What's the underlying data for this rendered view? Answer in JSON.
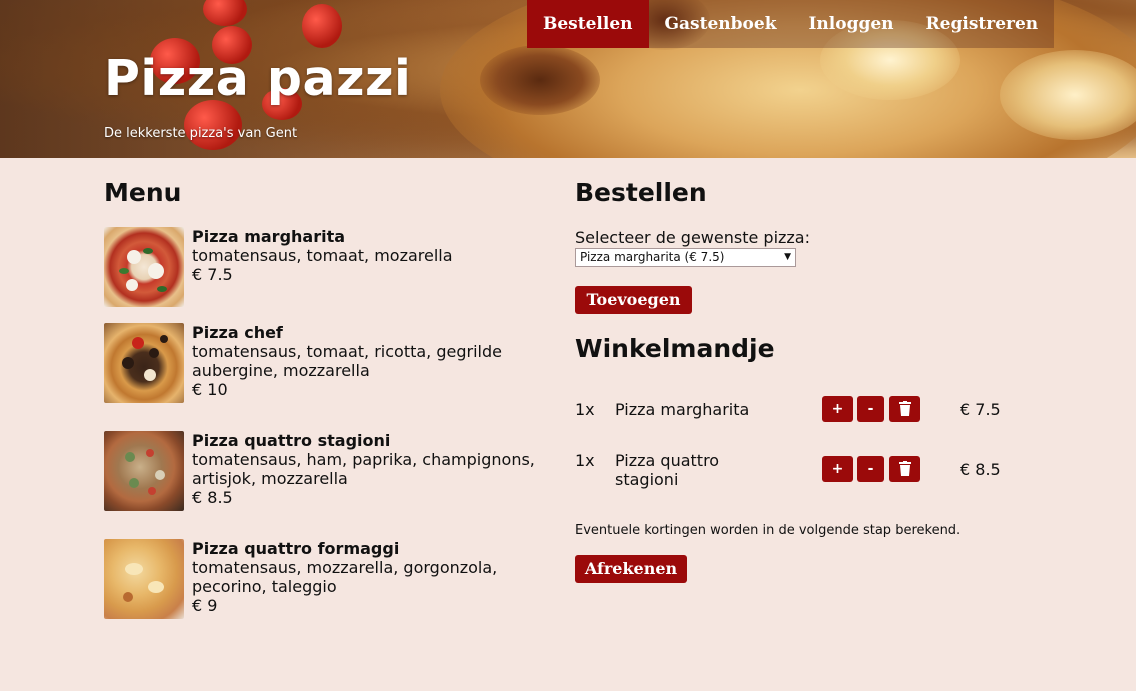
{
  "header": {
    "title": "Pizza pazzi",
    "subtitle": "De lekkerste pizza's van Gent",
    "nav": [
      {
        "label": "Bestellen",
        "active": true
      },
      {
        "label": "Gastenboek",
        "active": false
      },
      {
        "label": "Inloggen",
        "active": false
      },
      {
        "label": "Registreren",
        "active": false
      }
    ]
  },
  "menu": {
    "heading": "Menu",
    "items": [
      {
        "name": "Pizza margharita",
        "ingredients": "tomatensaus, tomaat, mozarella",
        "price": "€ 7.5"
      },
      {
        "name": "Pizza chef",
        "ingredients": "tomatensaus, tomaat, ricotta, gegrilde aubergine, mozzarella",
        "price": "€ 10"
      },
      {
        "name": "Pizza quattro stagioni",
        "ingredients": "tomatensaus, ham, paprika, champignons, artisjok, mozzarella",
        "price": "€ 8.5"
      },
      {
        "name": "Pizza quattro formaggi",
        "ingredients": "tomatensaus, mozzarella, gorgonzola, pecorino, taleggio",
        "price": "€ 9"
      }
    ]
  },
  "order": {
    "heading": "Bestellen",
    "select_label": "Selecteer de gewenste pizza:",
    "select_value": "Pizza margharita (€ 7.5)",
    "add_button": "Toevoegen"
  },
  "cart": {
    "heading": "Winkelmandje",
    "rows": [
      {
        "qty": "1x",
        "name": "Pizza margharita",
        "price": "€ 7.5"
      },
      {
        "qty": "1x",
        "name": "Pizza quattro stagioni",
        "price": "€ 8.5"
      }
    ],
    "plus_label": "+",
    "minus_label": "-",
    "note": "Eventuele kortingen worden in de volgende stap berekend.",
    "checkout_button": "Afrekenen"
  },
  "colors": {
    "accent": "#9b0a0a",
    "background": "#f5e6e0"
  }
}
